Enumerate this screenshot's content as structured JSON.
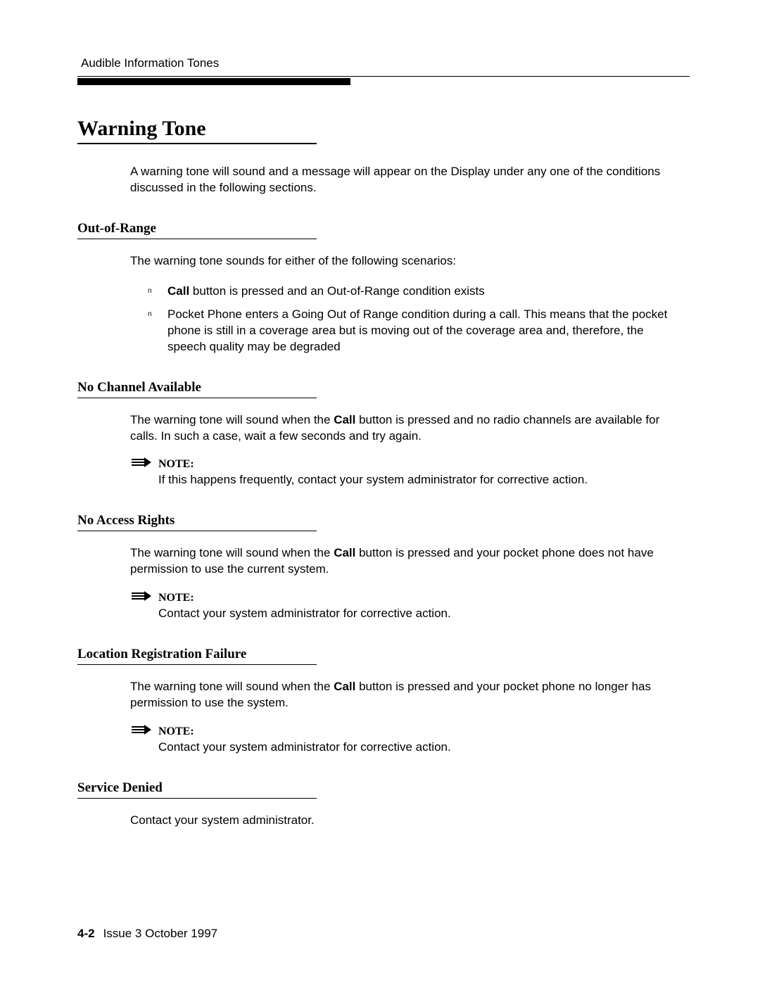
{
  "header": {
    "running_head": "Audible Information Tones"
  },
  "title": "Warning Tone",
  "intro": "A warning tone will sound and a message will appear on the Display under any one of the conditions discussed in the following sections.",
  "sections": {
    "out_of_range": {
      "heading": "Out-of-Range",
      "intro": "The warning tone sounds for either of the following scenarios:",
      "bullets": {
        "b1_pre": "",
        "b1_bold": "Call",
        "b1_post": " button is pressed and an Out-of-Range condition exists",
        "b2_pre": "Pocket Phone",
        "b2_post": " enters a Going Out of Range condition during a call. This means that the pocket phone is still in a coverage area but is moving out of the coverage area and, therefore, the speech quality may be degraded"
      }
    },
    "no_channel": {
      "heading": "No Channel Available",
      "para_pre": "The warning tone will sound when the ",
      "para_bold": "Call",
      "para_post": " button is pressed and no radio channels are available for calls. In such a case, wait a few seconds and try again.",
      "note_label": "NOTE:",
      "note_text": "If this happens frequently, contact your system administrator for corrective action."
    },
    "no_access": {
      "heading": "No Access Rights",
      "para_pre": "The warning tone will sound when the ",
      "para_bold": "Call",
      "para_post": " button is pressed and your pocket phone does not have permission to use the current system.",
      "note_label": "NOTE:",
      "note_text": "Contact your system administrator for corrective action."
    },
    "loc_reg": {
      "heading": "Location Registration Failure",
      "para_pre": "The warning tone will sound when the ",
      "para_bold": "Call",
      "para_post": " button is pressed and your pocket phone no longer has permission to use the system.",
      "note_label": "NOTE:",
      "note_text": "Contact your system administrator for corrective action."
    },
    "service_denied": {
      "heading": "Service Denied",
      "para": "Contact your system administrator."
    }
  },
  "footer": {
    "page_num": "4-2",
    "issue": "Issue 3   October 1997"
  }
}
